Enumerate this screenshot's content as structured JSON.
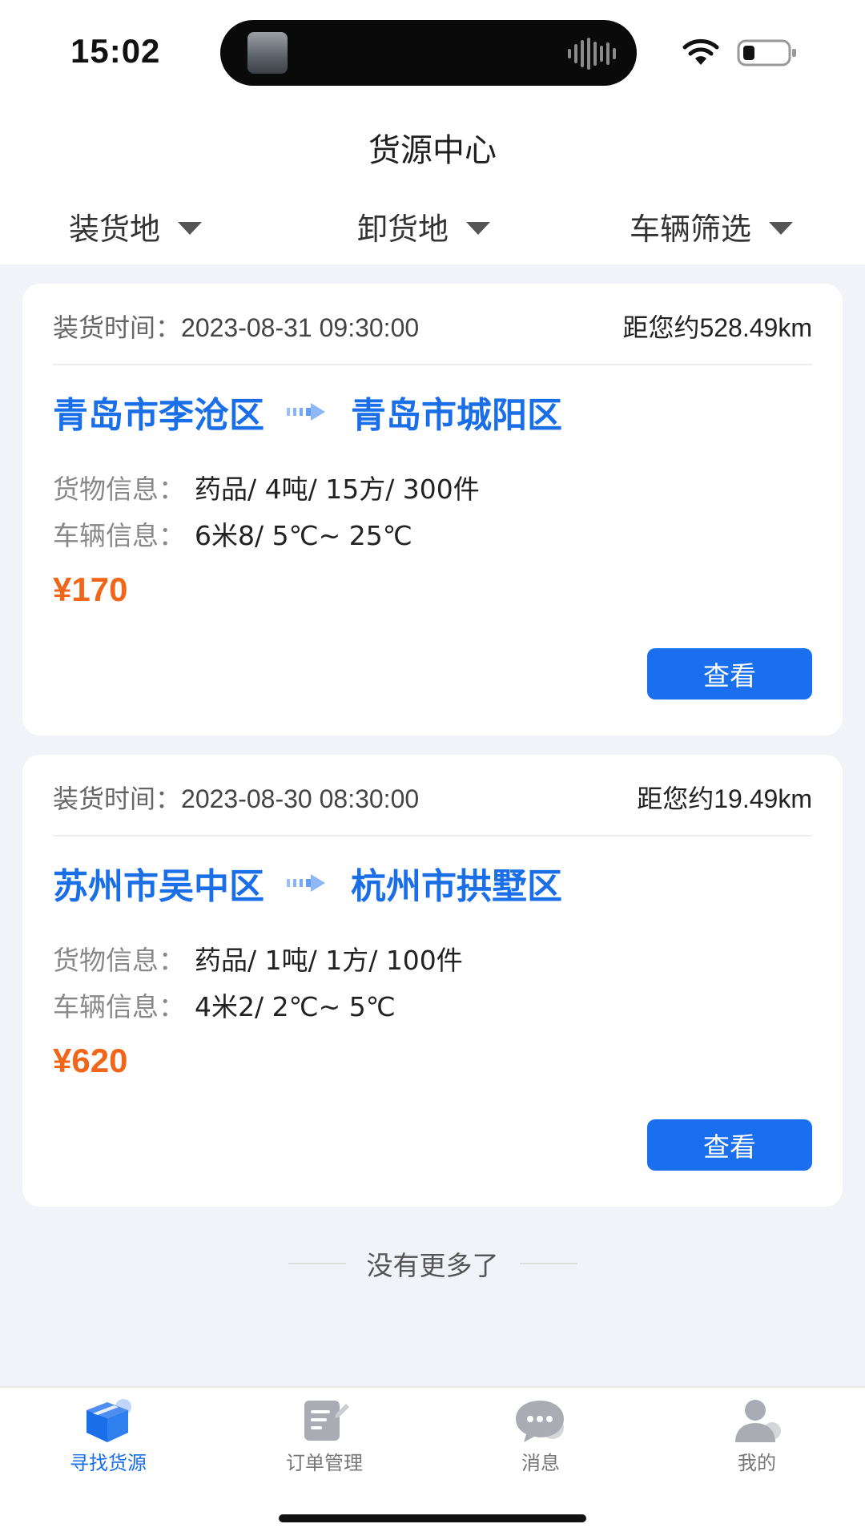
{
  "status_bar": {
    "time": "15:02"
  },
  "header": {
    "title": "货源中心",
    "filters": [
      {
        "label": "装货地"
      },
      {
        "label": "卸货地"
      },
      {
        "label": "车辆筛选"
      }
    ]
  },
  "cards": [
    {
      "load_time_label": "装货时间：",
      "load_time": "2023-08-31 09:30:00",
      "distance": "距您约528.49km",
      "origin": "青岛市李沧区",
      "destination": "青岛市城阳区",
      "cargo_label": "货物信息：",
      "cargo": "药品/ 4吨/ 15方/ 300件",
      "vehicle_label": "车辆信息：",
      "vehicle": "6米8/ 5℃~ 25℃",
      "price": "¥170",
      "button": "查看"
    },
    {
      "load_time_label": "装货时间：",
      "load_time": "2023-08-30 08:30:00",
      "distance": "距您约19.49km",
      "origin": "苏州市吴中区",
      "destination": "杭州市拱墅区",
      "cargo_label": "货物信息：",
      "cargo": "药品/ 1吨/ 1方/ 100件",
      "vehicle_label": "车辆信息：",
      "vehicle": "4米2/ 2℃~ 5℃",
      "price": "¥620",
      "button": "查看"
    }
  ],
  "footer_text": "没有更多了",
  "tabs": [
    {
      "label": "寻找货源",
      "icon": "box-icon",
      "active": true
    },
    {
      "label": "订单管理",
      "icon": "order-icon",
      "active": false
    },
    {
      "label": "消息",
      "icon": "chat-icon",
      "active": false
    },
    {
      "label": "我的",
      "icon": "user-icon",
      "active": false
    }
  ],
  "colors": {
    "accent": "#1A6FE8",
    "price": "#F2661A",
    "background": "#F2F3F8"
  }
}
